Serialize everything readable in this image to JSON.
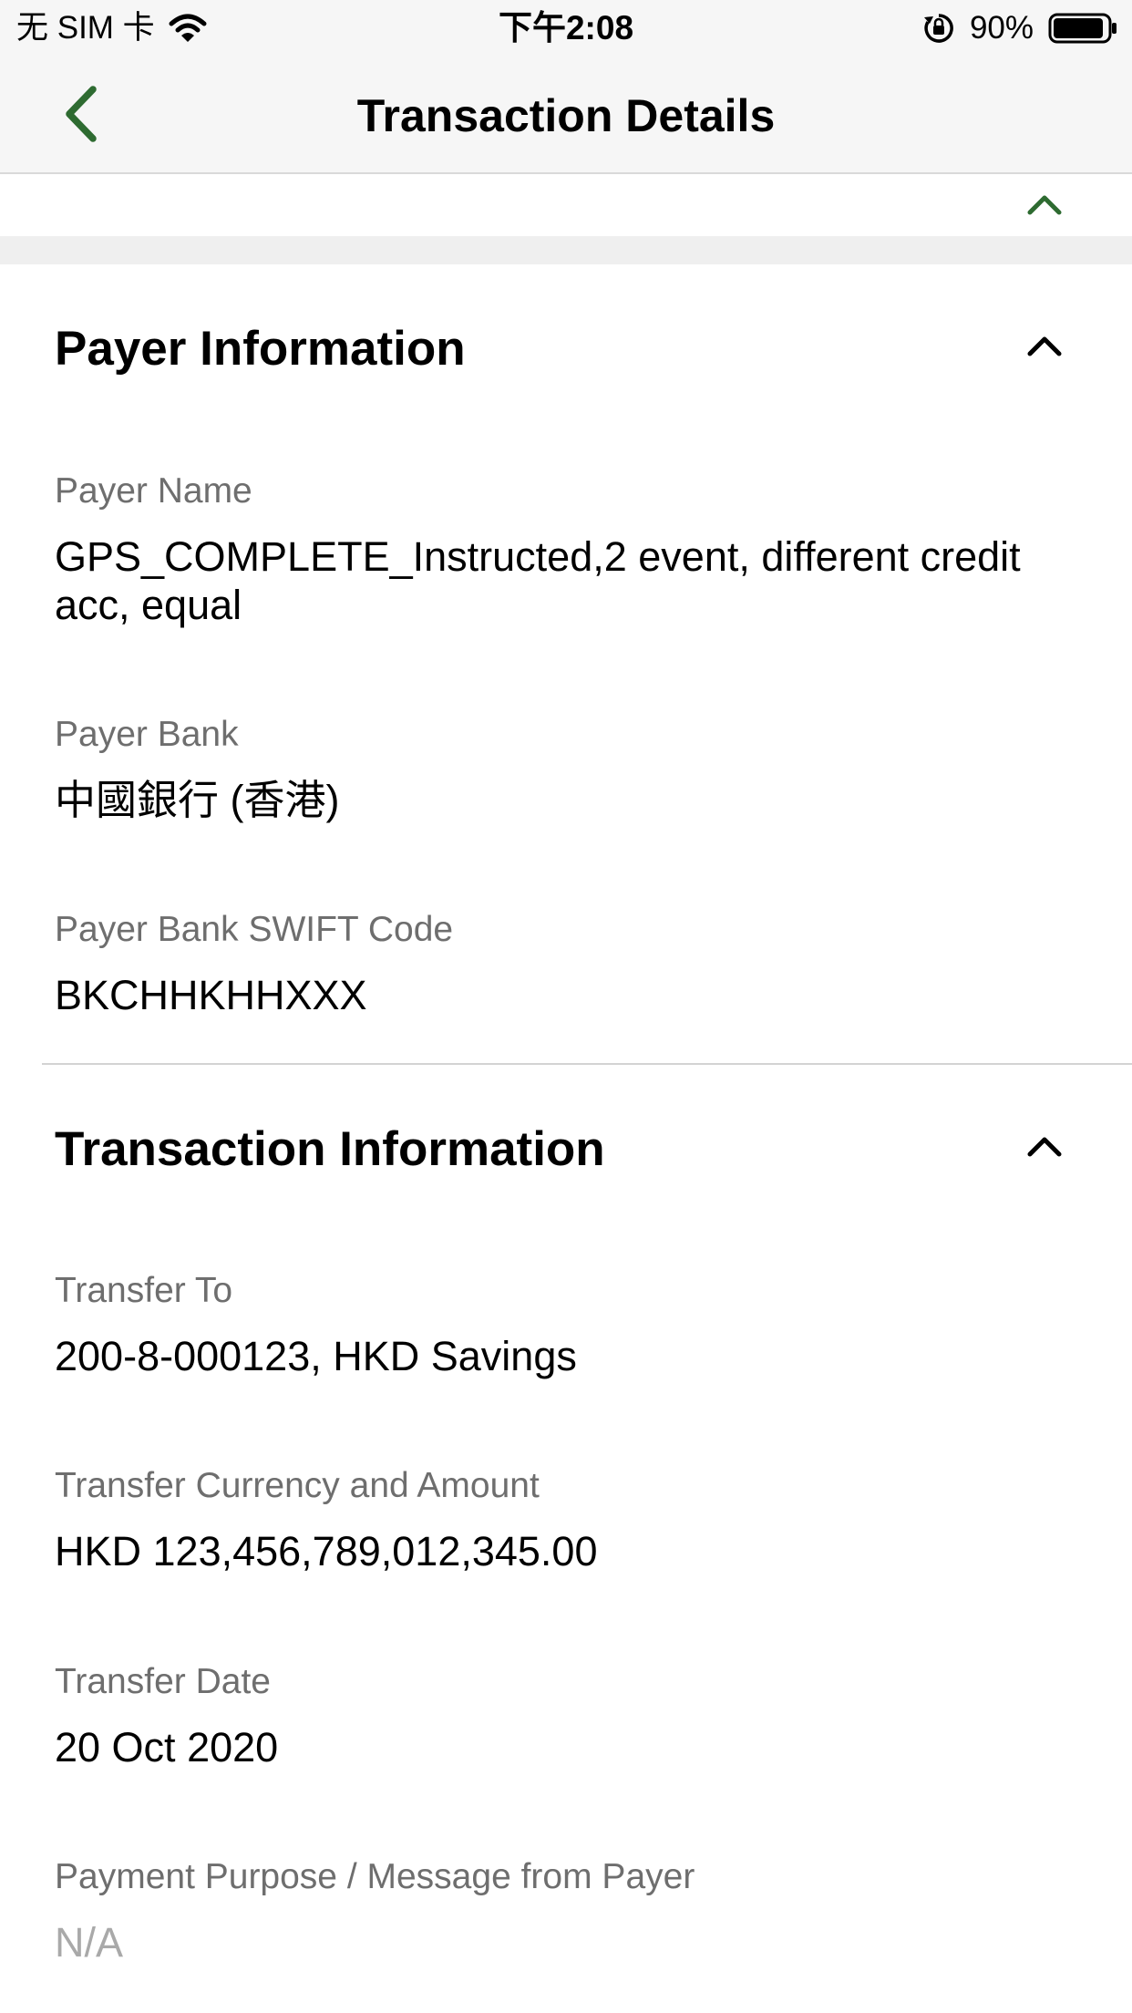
{
  "status_bar": {
    "carrier": "无 SIM 卡",
    "time": "下午2:08",
    "battery_percent": "90%",
    "battery_level": 0.9
  },
  "nav": {
    "title": "Transaction Details"
  },
  "colors": {
    "accent_green": "#2e6b31",
    "label_gray": "#6e6e6e",
    "muted_gray": "#a9a9a9"
  },
  "payer_section": {
    "title": "Payer Information",
    "fields": [
      {
        "label": "Payer Name",
        "value": "GPS_COMPLETE_Instructed,2 event, different credit acc, equal"
      },
      {
        "label": "Payer Bank",
        "value": "中國銀行 (香港)"
      },
      {
        "label": "Payer Bank SWIFT Code",
        "value": "BKCHHKHHXXX"
      }
    ]
  },
  "transaction_section": {
    "title": "Transaction Information",
    "fields": [
      {
        "label": "Transfer To",
        "value": "200-8-000123, HKD Savings"
      },
      {
        "label": "Transfer Currency and Amount",
        "value": "HKD 123,456,789,012,345.00"
      },
      {
        "label": "Transfer Date",
        "value": "20 Oct 2020"
      },
      {
        "label": "Payment Purpose / Message from Payer",
        "value": "N/A"
      }
    ]
  }
}
